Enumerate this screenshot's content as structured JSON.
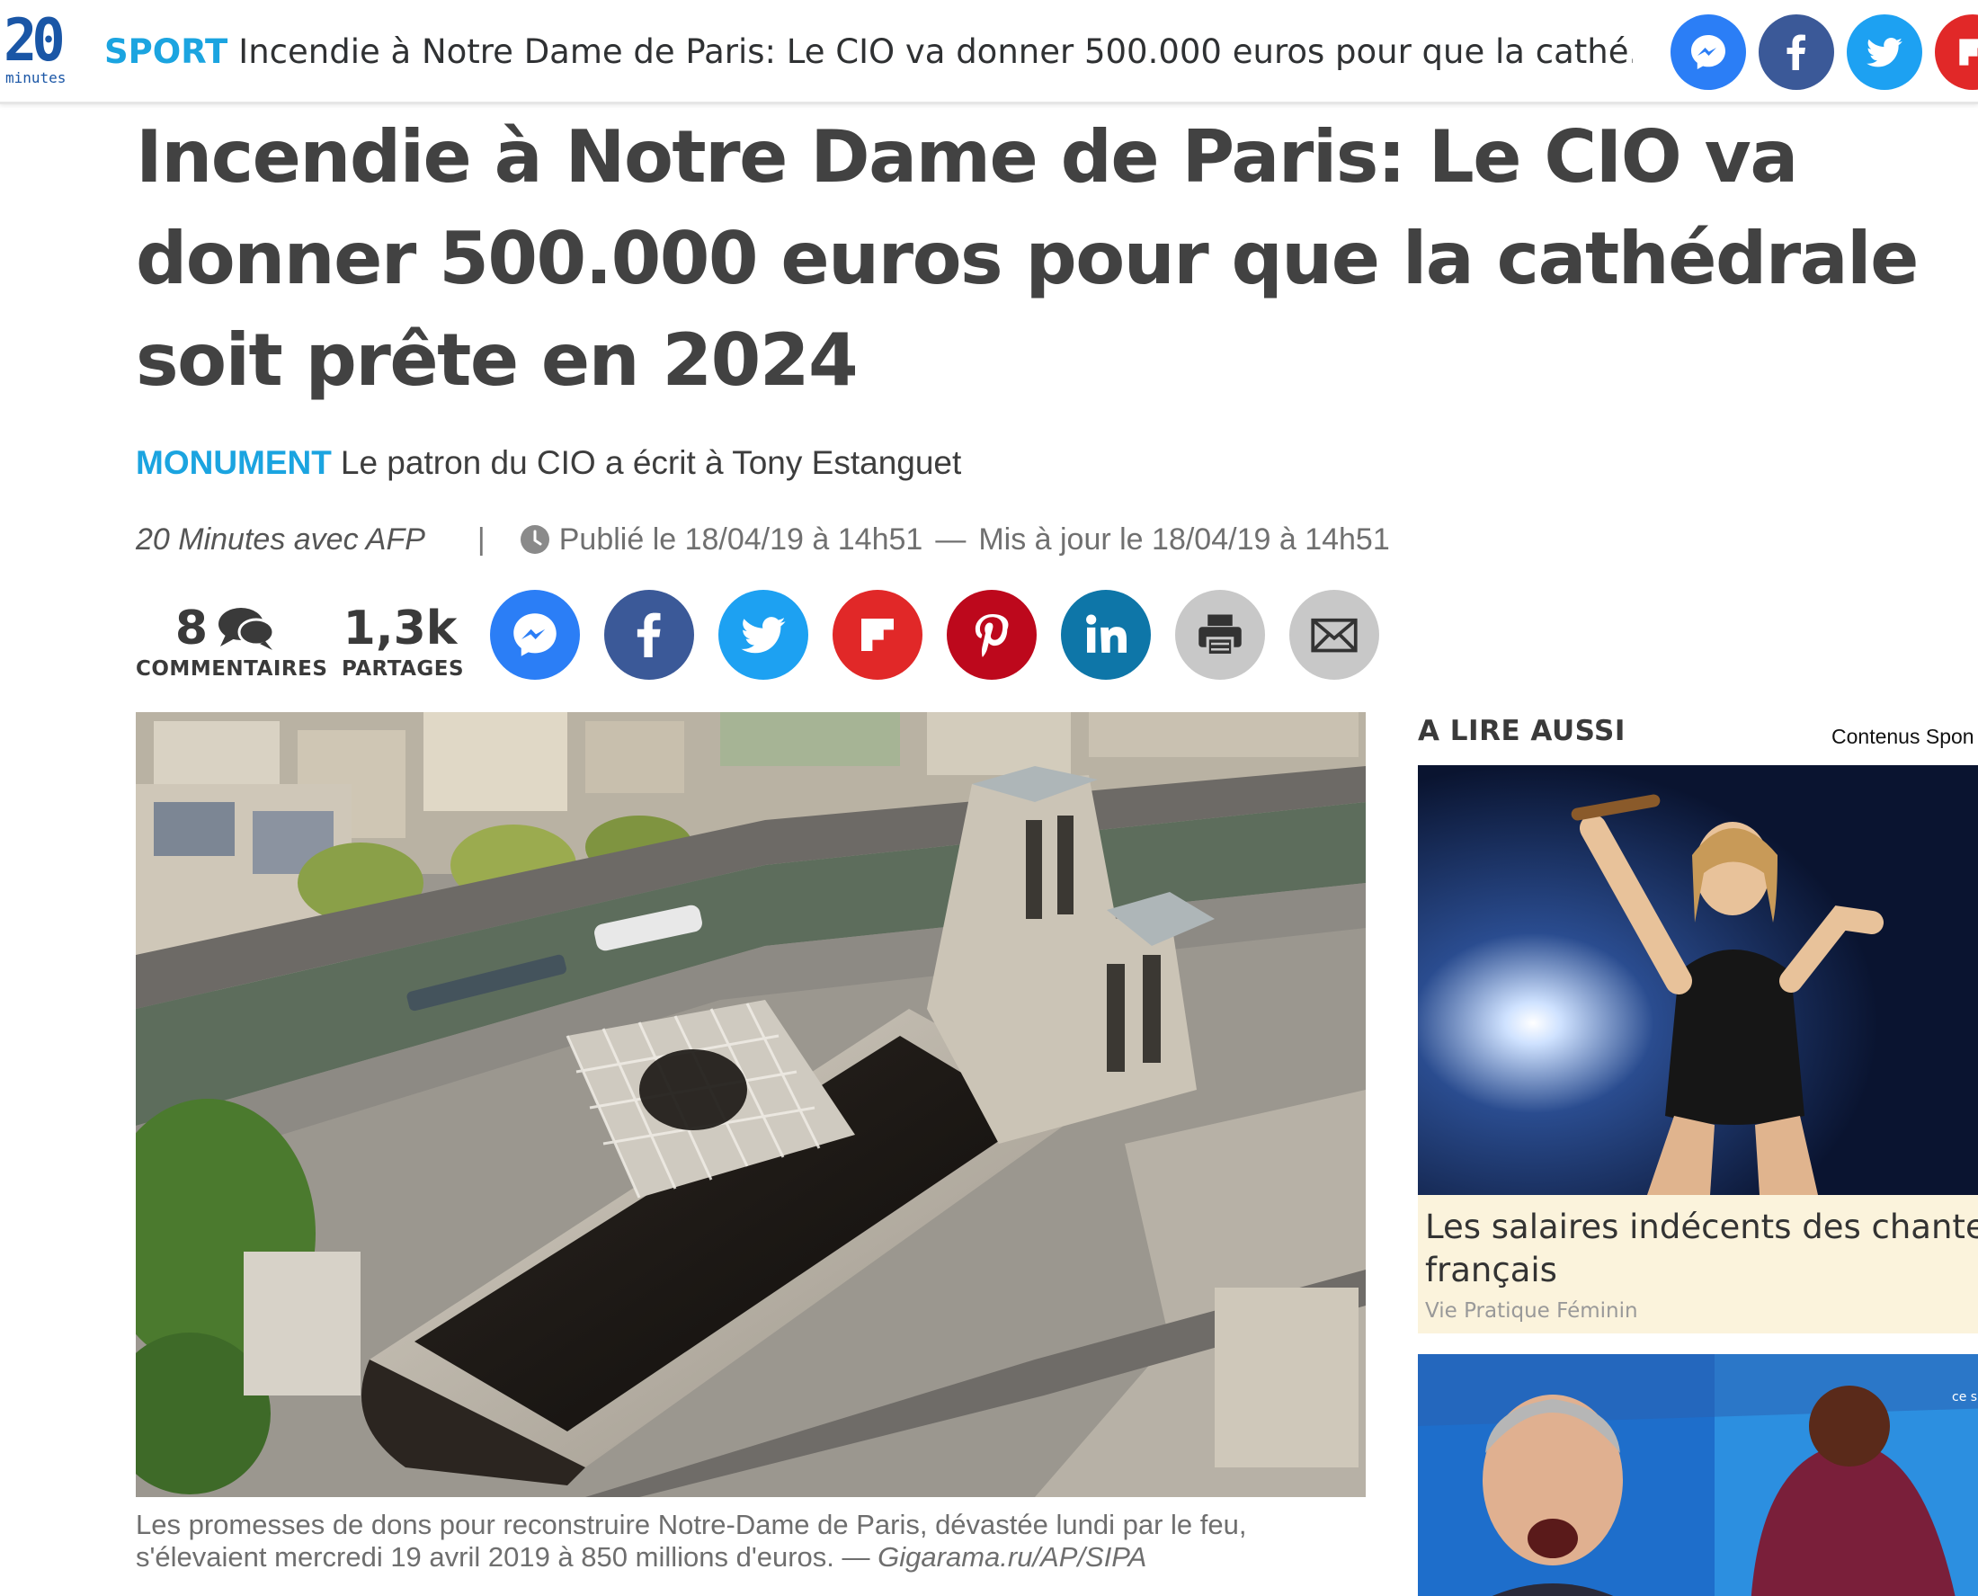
{
  "topbar": {
    "logo_number": "20",
    "logo_word": "minutes",
    "kicker": "SPORT",
    "headline": "Incendie à Notre Dame de Paris: Le CIO va donner 500.000 euros pour que la cathé...",
    "share_icons": [
      "messenger-icon",
      "facebook-icon",
      "twitter-icon",
      "flipboard-icon"
    ]
  },
  "article": {
    "title_lines": [
      "Incendie à Notre Dame de Paris: Le CIO va",
      "donner 500.000 euros pour que la cathédrale",
      "soit prête en 2024"
    ],
    "kicker": "MONUMENT",
    "subtitle": "Le patron du CIO a écrit à Tony Estanguet",
    "author": "20 Minutes avec AFP",
    "separator": "|",
    "published": "Publié le 18/04/19 à 14h51",
    "dash": "—",
    "updated": "Mis à jour le 18/04/19 à 14h51",
    "comments_count": "8",
    "comments_label": "COMMENTAIRES",
    "shares_count": "1,3k",
    "shares_label": "PARTAGES",
    "caption": "Les promesses de dons pour reconstruire Notre-Dame de Paris, dévastée lundi par le feu, s'élevaient mercredi 19 avril 2019 à 850 millions d'euros.",
    "caption_sep": " — ",
    "caption_credit": "Gigarama.ru/AP/SIPA"
  },
  "share_buttons": [
    {
      "icon": "messenger-icon",
      "color": "#2b7ef6"
    },
    {
      "icon": "facebook-icon",
      "color": "#3b5998"
    },
    {
      "icon": "twitter-icon",
      "color": "#1da1f2"
    },
    {
      "icon": "flipboard-icon",
      "color": "#e12828"
    },
    {
      "icon": "pinterest-icon",
      "color": "#bd081c"
    },
    {
      "icon": "linkedin-icon",
      "color": "#0e76a8"
    },
    {
      "icon": "printer-icon",
      "color": "#c8c8c8"
    },
    {
      "icon": "mail-icon",
      "color": "#c8c8c8"
    }
  ],
  "sidebar": {
    "title": "A LIRE AUSSI",
    "sponsor_label": "Contenus Spon",
    "card1": {
      "title_lines": [
        "Les salaires indécents des chanteu",
        "français"
      ],
      "source": "Vie Pratique Féminin"
    },
    "card2_overlay": "ce s"
  },
  "colors": {
    "accent": "#1ba4e0",
    "logo": "#1a56a6",
    "headline": "#424242",
    "card_bg": "#fbf3dc"
  }
}
